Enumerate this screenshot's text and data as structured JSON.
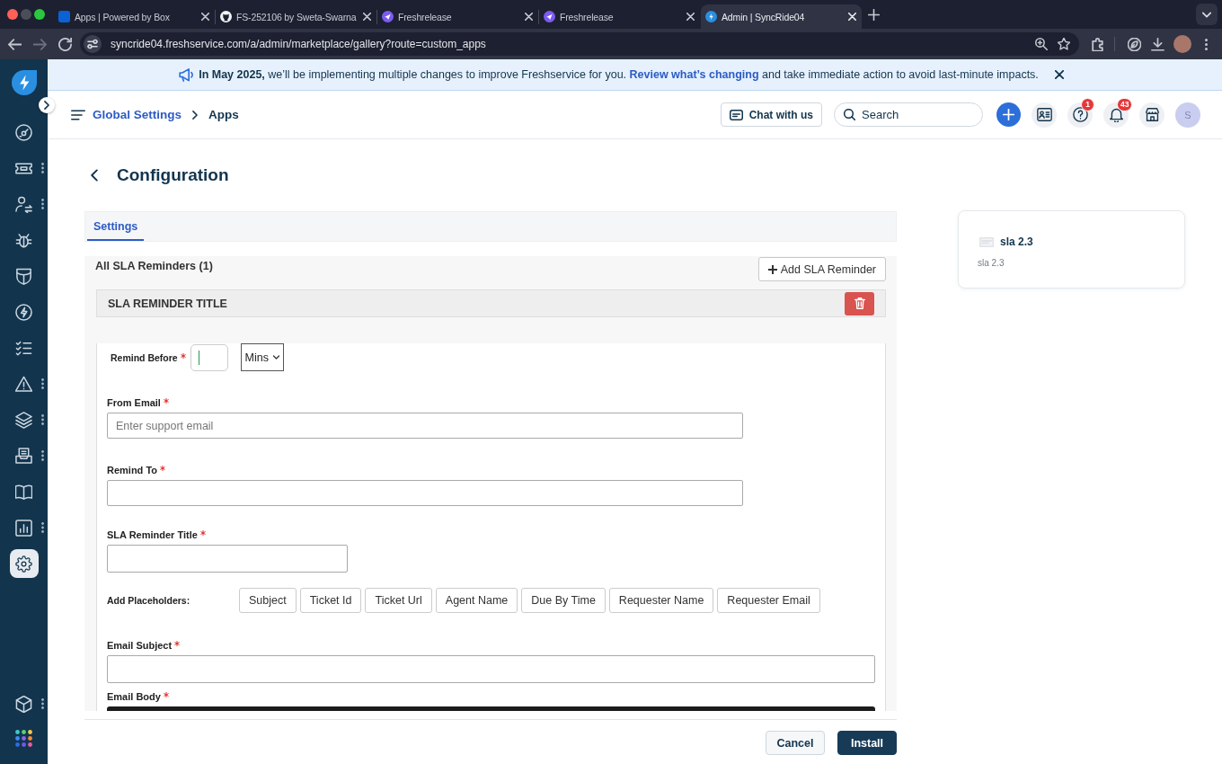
{
  "browser": {
    "tabs": [
      {
        "kind": "square",
        "title": "Apps | Powered by Box",
        "selected": false
      },
      {
        "kind": "circle",
        "title": "FS-252106 by Sweta-Swarna",
        "selected": false
      },
      {
        "kind": "plane",
        "title": "Freshrelease",
        "selected": false
      },
      {
        "kind": "plane",
        "title": "Freshrelease",
        "selected": false
      },
      {
        "kind": "bolt",
        "title": "Admin | SyncRide04",
        "selected": true
      }
    ],
    "address": "syncride04.freshservice.com/a/admin/marketplace/gallery?route=custom_apps"
  },
  "sidebar": {
    "items": [
      {
        "kind": "gauge",
        "menu": false,
        "selected": false
      },
      {
        "kind": "ticket",
        "menu": true,
        "selected": false
      },
      {
        "kind": "people",
        "menu": true,
        "selected": false
      },
      {
        "kind": "bug",
        "menu": false,
        "selected": false
      },
      {
        "kind": "shield",
        "menu": false,
        "selected": false
      },
      {
        "kind": "bolt",
        "menu": false,
        "selected": false
      },
      {
        "kind": "checklist",
        "menu": false,
        "selected": false
      },
      {
        "kind": "warning",
        "menu": true,
        "selected": false
      },
      {
        "kind": "layers",
        "menu": true,
        "selected": false
      },
      {
        "kind": "tray",
        "menu": true,
        "selected": false
      },
      {
        "kind": "book",
        "menu": false,
        "selected": false
      },
      {
        "kind": "chart",
        "menu": true,
        "selected": false
      },
      {
        "kind": "gear",
        "menu": false,
        "selected": true
      }
    ],
    "bottom_items": [
      {
        "kind": "cube",
        "menu": true,
        "selected": false
      },
      {
        "kind": "apps",
        "menu": false,
        "selected": false
      }
    ]
  },
  "banner": {
    "text": "**In May 2025,** we’ll be implementing multiple changes to improve Freshservice for you.",
    "link": "Review what’s changing",
    "text_after": "and take immediate action to avoid last-minute impacts."
  },
  "header": {
    "breadcrumb": [
      {
        "kind": "link",
        "label": "Global Settings"
      },
      {
        "kind": "current",
        "label": "Apps"
      }
    ],
    "chat_button": "Chat with us",
    "search": {
      "placeholder": "Search"
    },
    "icon_buttons": [
      {
        "kind": "contacts"
      },
      {
        "kind": "help",
        "badge": "1"
      },
      {
        "kind": "bell",
        "badge": "43"
      },
      {
        "kind": "store"
      }
    ],
    "avatar": "S"
  },
  "page": {
    "title": "Configuration",
    "tabs": [
      {
        "label": "Settings",
        "selected": true
      }
    ]
  },
  "reminders": {
    "heading": "All SLA Reminders (1)",
    "add_button": "Add SLA Reminder",
    "cards": [
      {
        "title": "SLA REMINDER TITLE",
        "fields": [
          {
            "kind": "duration",
            "label": "Remind Before",
            "required": true,
            "focused": true,
            "unit": "Mins"
          },
          {
            "kind": "email",
            "label": "From Email",
            "required": true,
            "focused": false,
            "placeholder": "Enter support email"
          },
          {
            "kind": "email",
            "label": "Remind To",
            "required": true,
            "focused": false
          },
          {
            "kind": "title",
            "label": "SLA Reminder Title",
            "required": true,
            "focused": false
          },
          {
            "kind": "placeholders",
            "label": "Add Placeholders:",
            "required": false,
            "options": [
              "Subject",
              "Ticket Id",
              "Ticket Url",
              "Agent Name",
              "Due By Time",
              "Requester Name",
              "Requester Email"
            ]
          },
          {
            "kind": "subject",
            "label": "Email Subject",
            "required": true,
            "focused": false
          },
          {
            "kind": "editor",
            "label": "Email Body",
            "required": true
          }
        ]
      }
    ]
  },
  "app_card": {
    "title": "sla 2.3",
    "subtitle": "sla 2.3"
  },
  "footer": {
    "buttons": [
      {
        "kind": "secondary",
        "label": "Cancel"
      },
      {
        "kind": "primary",
        "label": "Install"
      }
    ]
  }
}
